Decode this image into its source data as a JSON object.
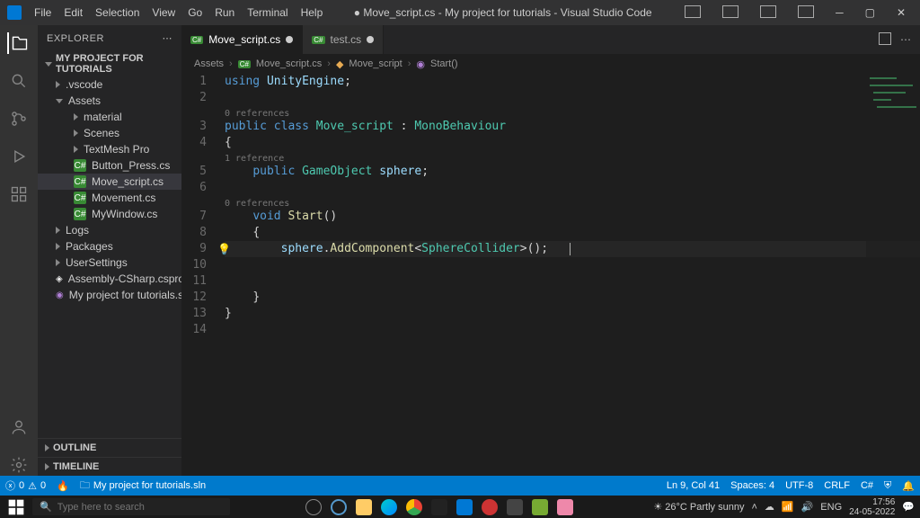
{
  "titlebar": {
    "menus": [
      "File",
      "Edit",
      "Selection",
      "View",
      "Go",
      "Run",
      "Terminal",
      "Help"
    ],
    "title": "● Move_script.cs - My project for tutorials - Visual Studio Code"
  },
  "sidebar": {
    "header": "EXPLORER",
    "project": "MY PROJECT FOR TUTORIALS",
    "tree": [
      {
        "label": ".vscode",
        "type": "folder",
        "expanded": false,
        "depth": 2
      },
      {
        "label": "Assets",
        "type": "folder",
        "expanded": true,
        "depth": 2
      },
      {
        "label": "material",
        "type": "folder",
        "expanded": false,
        "depth": 3
      },
      {
        "label": "Scenes",
        "type": "folder",
        "expanded": false,
        "depth": 3
      },
      {
        "label": "TextMesh Pro",
        "type": "folder",
        "expanded": false,
        "depth": 3
      },
      {
        "label": "Button_Press.cs",
        "type": "cs",
        "depth": 3
      },
      {
        "label": "Move_script.cs",
        "type": "cs",
        "depth": 3,
        "active": true
      },
      {
        "label": "Movement.cs",
        "type": "cs",
        "depth": 3
      },
      {
        "label": "MyWindow.cs",
        "type": "cs",
        "depth": 3
      },
      {
        "label": "Logs",
        "type": "folder",
        "expanded": false,
        "depth": 2
      },
      {
        "label": "Packages",
        "type": "folder",
        "expanded": false,
        "depth": 2
      },
      {
        "label": "UserSettings",
        "type": "folder",
        "expanded": false,
        "depth": 2
      },
      {
        "label": "Assembly-CSharp.csproj",
        "type": "unity",
        "depth": 2
      },
      {
        "label": "My project for tutorials.sln",
        "type": "sln",
        "depth": 2
      }
    ],
    "outline": "OUTLINE",
    "timeline": "TIMELINE"
  },
  "tabs": [
    {
      "label": "Move_script.cs",
      "modified": true,
      "active": true
    },
    {
      "label": "test.cs",
      "modified": true,
      "active": false
    }
  ],
  "breadcrumb": [
    "Assets",
    "Move_script.cs",
    "Move_script",
    "Start()"
  ],
  "code": {
    "ref0": "0 references",
    "ref1": "1 reference",
    "l1": {
      "k": "using",
      "id": " UnityEngine",
      "p": ";"
    },
    "l3": {
      "k": "public class ",
      "cls": "Move_script",
      "p": " : ",
      "cls2": "MonoBehaviour"
    },
    "l5": {
      "k": "public ",
      "cls": "GameObject",
      "id": " sphere",
      "p": ";"
    },
    "l7": {
      "k": "void ",
      "fn": "Start",
      "p": "()"
    },
    "l9": {
      "id": "sphere",
      "p1": ".",
      "fn": "AddComponent",
      "p2": "<",
      "cls": "SphereCollider",
      "p3": ">();"
    }
  },
  "statusbar": {
    "errors": "0",
    "warnings": "0",
    "project": "My project for tutorials.sln",
    "pos": "Ln 9, Col 41",
    "spaces": "Spaces: 4",
    "enc": "UTF-8",
    "eol": "CRLF",
    "lang": "C#"
  },
  "taskbar": {
    "search_placeholder": "Type here to search",
    "weather": "26°C  Partly sunny",
    "lang": "ENG",
    "time": "17:56",
    "date": "24-05-2022"
  }
}
